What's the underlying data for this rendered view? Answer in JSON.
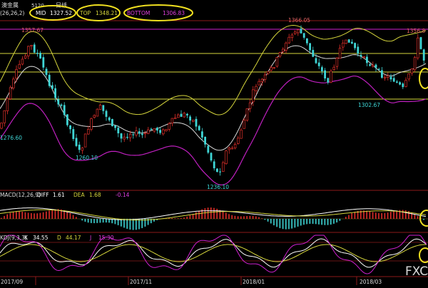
{
  "header": {
    "symbol": "澳金属",
    "code": "5120",
    "period": "日线",
    "boll_params": "(26,26,2)",
    "mid_label": "MID",
    "mid_value": "1327.52",
    "top_label": "TOP",
    "top_value": "1348.21",
    "bottom_label": "BOTTOM",
    "bottom_value": "1306.83"
  },
  "price_annotations": {
    "p1357": "1357.67",
    "p1366": "1366.05",
    "p1356": "1356.8",
    "p1302": "1302.67",
    "p1260": "1260.10",
    "p1236": "1236.10",
    "p1276": "1276.60"
  },
  "macd": {
    "label": "MACD(12,26,9)",
    "diff_label": "DIFF",
    "diff_value": "1.61",
    "dea_label": "DEA",
    "dea_value": "1.68",
    "macd_value": "-0.14"
  },
  "kdj": {
    "label": "KDJ(9,3,3)",
    "k_label": "K",
    "k_value": "34.55",
    "d_label": "D",
    "d_value": "44.17",
    "j_label": "J",
    "j_value": "15.30"
  },
  "x_axis": [
    "2017/09",
    "2017/11",
    "2018/01",
    "2018/03"
  ],
  "watermark": "FXC",
  "colors": {
    "up": "#e0302a",
    "down": "#3fd6d6",
    "mid_line": "#ffffff",
    "top_line": "#d6d63c",
    "bottom_line": "#c020c0",
    "highlight_ellipse": "#f0e020",
    "label_cyan": "#3fd6d6",
    "label_magenta": "#e040e0"
  }
}
